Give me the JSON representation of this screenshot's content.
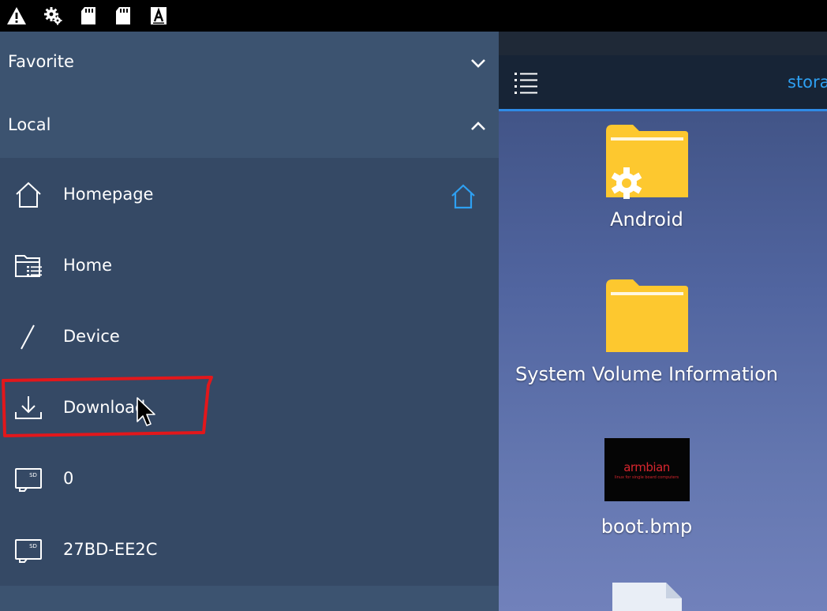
{
  "status_bar": {
    "icons": [
      "warning-icon",
      "settings-icon",
      "sd-card-icon",
      "sd-card-icon",
      "text-a-icon"
    ]
  },
  "drawer": {
    "sections": {
      "favorite": {
        "title": "Favorite",
        "state": "collapsed",
        "icon": "chevron-down-icon"
      },
      "local": {
        "title": "Local",
        "state": "expanded",
        "icon": "chevron-up-icon"
      }
    },
    "items": [
      {
        "label": "Homepage",
        "icon": "home-icon"
      },
      {
        "label": "Home",
        "icon": "folder-list-icon"
      },
      {
        "label": "Device",
        "icon": "slash-icon"
      },
      {
        "label": "Download",
        "icon": "download-icon"
      },
      {
        "label": "0",
        "icon": "sd-card-icon"
      },
      {
        "label": "27BD-EE2C",
        "icon": "sd-card-icon"
      }
    ],
    "homepage_shortcut_icon": "home-icon",
    "selected": "Download"
  },
  "file_view": {
    "path": "stora",
    "menu_icon": "list-menu-icon",
    "items": [
      {
        "name": "Android",
        "type": "folder",
        "icon": "folder-gear-icon"
      },
      {
        "name": "System Volume Information",
        "type": "folder",
        "icon": "folder-icon"
      },
      {
        "name": "boot.bmp",
        "type": "image",
        "thumbnail_text": "armbian",
        "thumbnail_tagline": "linux for single board computers"
      },
      {
        "name": "",
        "type": "file",
        "icon": "file-icon"
      }
    ]
  },
  "colors": {
    "drawer_bg": "#354965",
    "section_header_bg": "#3c5370",
    "toolbar_bg": "#172436",
    "accent_blue": "#2ea0f2",
    "folder_yellow": "#fdc82f",
    "highlight_red": "#e3171b"
  }
}
